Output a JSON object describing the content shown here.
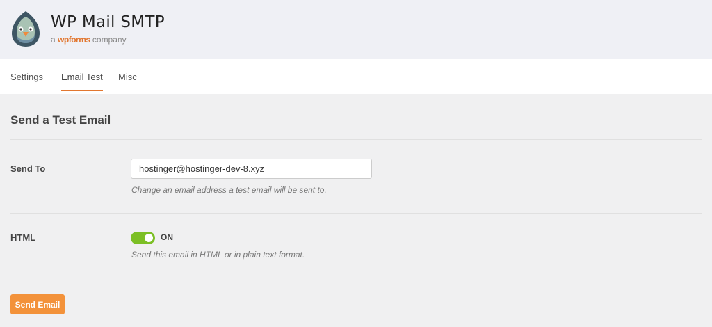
{
  "header": {
    "title": "WP Mail SMTP",
    "tagline_prefix": "a",
    "tagline_brand": "wpforms",
    "tagline_suffix": "company"
  },
  "tabs": [
    {
      "label": "Settings"
    },
    {
      "label": "Email Test",
      "active": true
    },
    {
      "label": "Misc"
    }
  ],
  "main": {
    "heading": "Send a Test Email",
    "send_to": {
      "label": "Send To",
      "value": "hostinger@hostinger-dev-8.xyz",
      "description": "Change an email address a test email will be sent to."
    },
    "html": {
      "label": "HTML",
      "toggle_state": "ON",
      "description": "Send this email in HTML or in plain text format."
    },
    "send_button": "Send Email"
  },
  "colors": {
    "accent": "#e27730",
    "toggle_on": "#7cbf25",
    "button": "#f3923a"
  }
}
